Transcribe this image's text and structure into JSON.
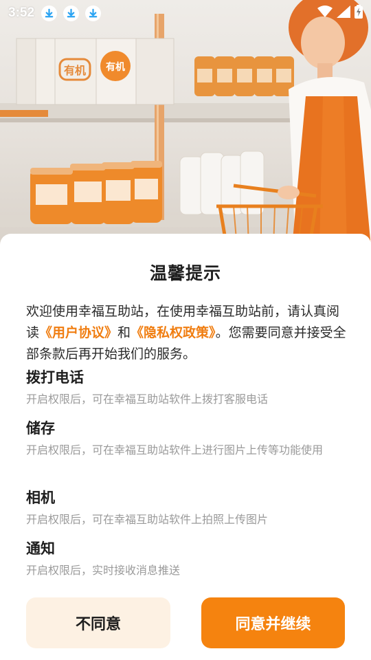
{
  "status_bar": {
    "time": "3:52",
    "notification_icons": [
      "download-icon",
      "download-icon",
      "download-icon"
    ],
    "right_icons": [
      "wifi-icon",
      "signal-icon",
      "battery-charging-icon"
    ]
  },
  "background": {
    "jar_label": "有机"
  },
  "dialog": {
    "title": "温馨提示",
    "intro_prefix": "欢迎使用幸福互助站，在使用幸福互助站前，请认真阅读",
    "user_agreement_link": "《用户协议》",
    "intro_and": "和",
    "privacy_policy_link": "《隐私权政策》",
    "intro_suffix": "。您需要同意并接受全部条款后再开始我们的服务。",
    "permissions": [
      {
        "name": "拨打电话",
        "desc": "开启权限后，可在幸福互助站软件上拨打客服电话"
      },
      {
        "name": "储存",
        "desc": "开启权限后，可在幸福互助站软件上进行图片上传等功能使用"
      },
      {
        "name": "相机",
        "desc": "开启权限后，可在幸福互助站软件上拍照上传图片"
      },
      {
        "name": "通知",
        "desc": "开启权限后，实时接收消息推送"
      }
    ],
    "disagree_label": "不同意",
    "agree_label": "同意并继续"
  },
  "colors": {
    "accent": "#f5830f",
    "link": "#f07d10",
    "disagree_bg": "#fdf1e3"
  }
}
